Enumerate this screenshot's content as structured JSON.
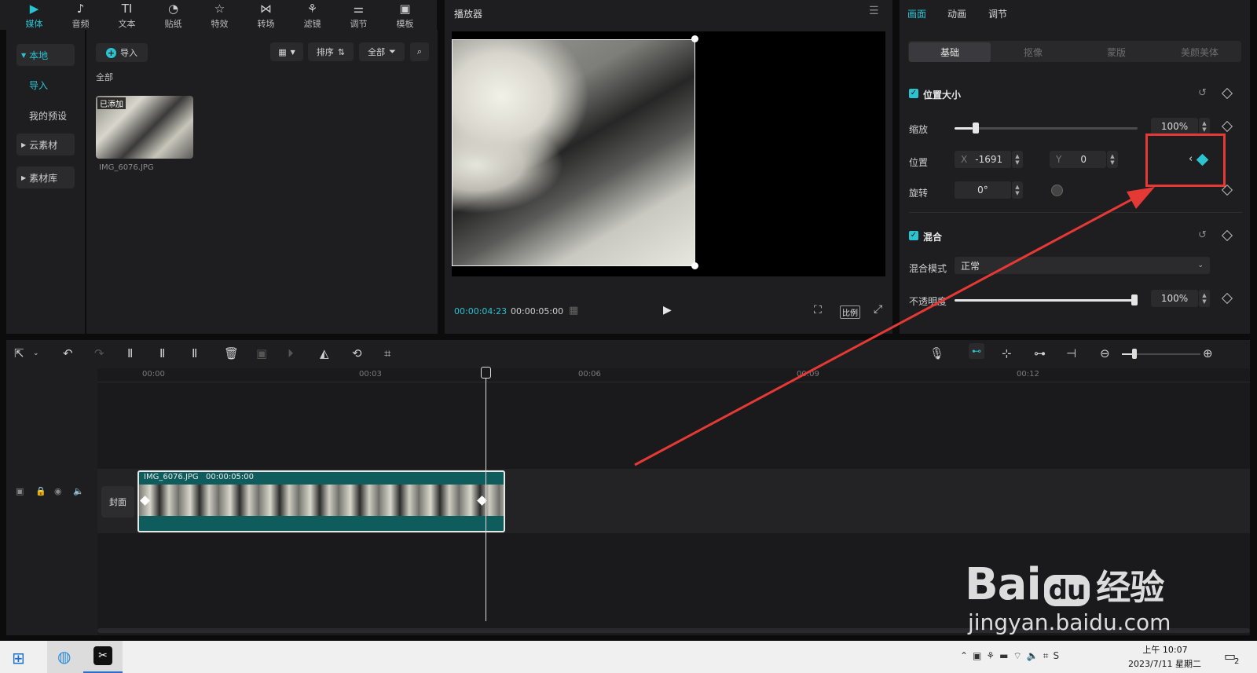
{
  "toolbar": {
    "tabs": [
      {
        "label": "媒体",
        "icon": "media-icon"
      },
      {
        "label": "音频",
        "icon": "audio-icon"
      },
      {
        "label": "文本",
        "icon": "text-icon"
      },
      {
        "label": "贴纸",
        "icon": "sticker-icon"
      },
      {
        "label": "特效",
        "icon": "effects-icon"
      },
      {
        "label": "转场",
        "icon": "transition-icon"
      },
      {
        "label": "滤镜",
        "icon": "filter-icon"
      },
      {
        "label": "调节",
        "icon": "adjust-icon"
      },
      {
        "label": "模板",
        "icon": "template-icon"
      }
    ]
  },
  "media": {
    "sidebar": [
      "本地",
      "导入",
      "我的预设",
      "云素材",
      "素材库"
    ],
    "import_label": "导入",
    "sort_label": "排序",
    "filter_label": "全部",
    "section_label": "全部",
    "item": {
      "badge": "已添加",
      "name": "IMG_6076.JPG"
    }
  },
  "player": {
    "title": "播放器",
    "current_time": "00:00:04:23",
    "total_time": "00:00:05:00",
    "ratio_label": "比例"
  },
  "props": {
    "tabs": [
      "画面",
      "动画",
      "调节"
    ],
    "sub_tabs": [
      "基础",
      "抠像",
      "蒙版",
      "美颜美体"
    ],
    "section_position": "位置大小",
    "scale_label": "缩放",
    "scale_value": "100%",
    "scale_level": 0.1,
    "position_label": "位置",
    "x_label": "X",
    "x_value": "-1691",
    "y_label": "Y",
    "y_value": "0",
    "rotate_label": "旋转",
    "rotate_value": "0°",
    "section_blend": "混合",
    "blend_mode_label": "混合模式",
    "blend_mode_value": "正常",
    "opacity_label": "不透明度",
    "opacity_value": "100%",
    "opacity_level": 1.0
  },
  "timeline": {
    "ruler": [
      "00:00",
      "00:03",
      "00:06",
      "00:09",
      "00:12"
    ],
    "cover_label": "封面",
    "clip_name": "IMG_6076.JPG",
    "clip_duration": "00:00:05:00"
  },
  "taskbar": {
    "time": "上午 10:07",
    "date": "2023/7/11 星期二",
    "notification_count": "2"
  },
  "watermark": {
    "brand": "Bai",
    "brand_du": "du",
    "brand_cn": "经验",
    "url": "jingyan.baidu.com"
  },
  "colors": {
    "accent": "#2bc3d0",
    "highlight": "#e53935",
    "clip": "#0f5c5c"
  }
}
